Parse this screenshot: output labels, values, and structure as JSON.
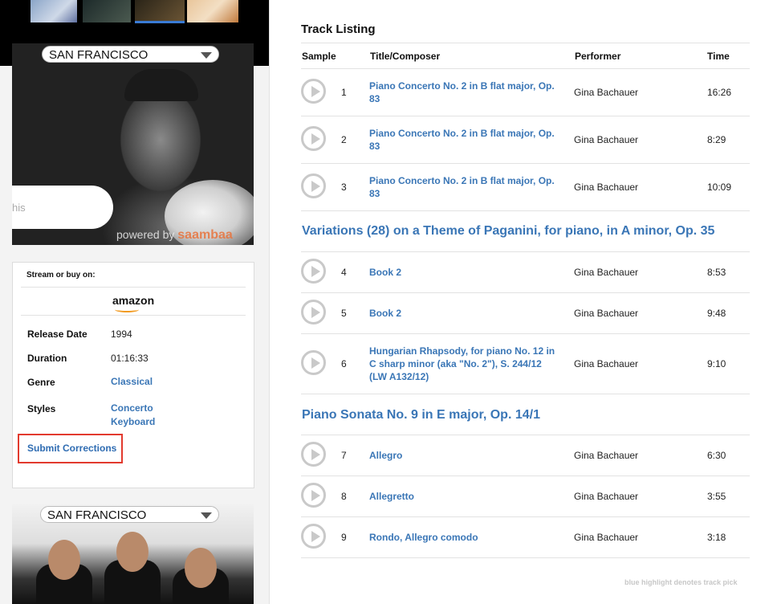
{
  "sidebar": {
    "ad1": {
      "city": "SAN FRANCISCO",
      "bubble_text": "his",
      "powered_text": "powered by",
      "powered_brand": "saambaa"
    },
    "ad2": {
      "city": "SAN FRANCISCO"
    },
    "info": {
      "stream_label": "Stream or buy on:",
      "store": "amazon",
      "release_date_label": "Release Date",
      "release_date": "1994",
      "duration_label": "Duration",
      "duration": "01:16:33",
      "genre_label": "Genre",
      "genre": "Classical",
      "styles_label": "Styles",
      "styles": [
        "Concerto",
        "Keyboard"
      ],
      "submit_label": "Submit Corrections"
    }
  },
  "tracklist": {
    "title": "Track Listing",
    "columns": {
      "sample": "Sample",
      "title": "Title/Composer",
      "performer": "Performer",
      "time": "Time"
    },
    "tracks": [
      {
        "num": "1",
        "title": [
          "Piano Concerto No. 2 in B flat major, Op.",
          "83"
        ],
        "performer": "Gina Bachauer",
        "time": "16:26"
      },
      {
        "num": "2",
        "title": [
          "Piano Concerto No. 2 in B flat major, Op.",
          "83"
        ],
        "performer": "Gina Bachauer",
        "time": "8:29"
      },
      {
        "num": "3",
        "title": [
          "Piano Concerto No. 2 in B flat major, Op.",
          "83"
        ],
        "performer": "Gina Bachauer",
        "time": "10:09"
      },
      {
        "num": "4",
        "title": [
          "Book 2"
        ],
        "performer": "Gina Bachauer",
        "time": "8:53"
      },
      {
        "num": "5",
        "title": [
          "Book 2"
        ],
        "performer": "Gina Bachauer",
        "time": "9:48"
      },
      {
        "num": "6",
        "title": [
          "Hungarian Rhapsody, for piano No. 12 in",
          "C sharp minor (aka \"No. 2\"), S. 244/12",
          "(LW A132/12)"
        ],
        "performer": "Gina Bachauer",
        "time": "9:10"
      },
      {
        "num": "7",
        "title": [
          "Allegro"
        ],
        "performer": "Gina Bachauer",
        "time": "6:30"
      },
      {
        "num": "8",
        "title": [
          "Allegretto"
        ],
        "performer": "Gina Bachauer",
        "time": "3:55"
      },
      {
        "num": "9",
        "title": [
          "Rondo, Allegro comodo"
        ],
        "performer": "Gina Bachauer",
        "time": "3:18"
      }
    ],
    "work_titles": [
      "Variations (28) on a Theme of Paganini, for piano, in A minor, Op. 35",
      "Piano Sonata No. 9 in E major, Op. 14/1"
    ],
    "footnote": "blue highlight denotes track pick"
  },
  "colors": {
    "link": "#3a76b6",
    "highlight_border": "#e23a2e",
    "play_icon": "#c9c9c9"
  }
}
